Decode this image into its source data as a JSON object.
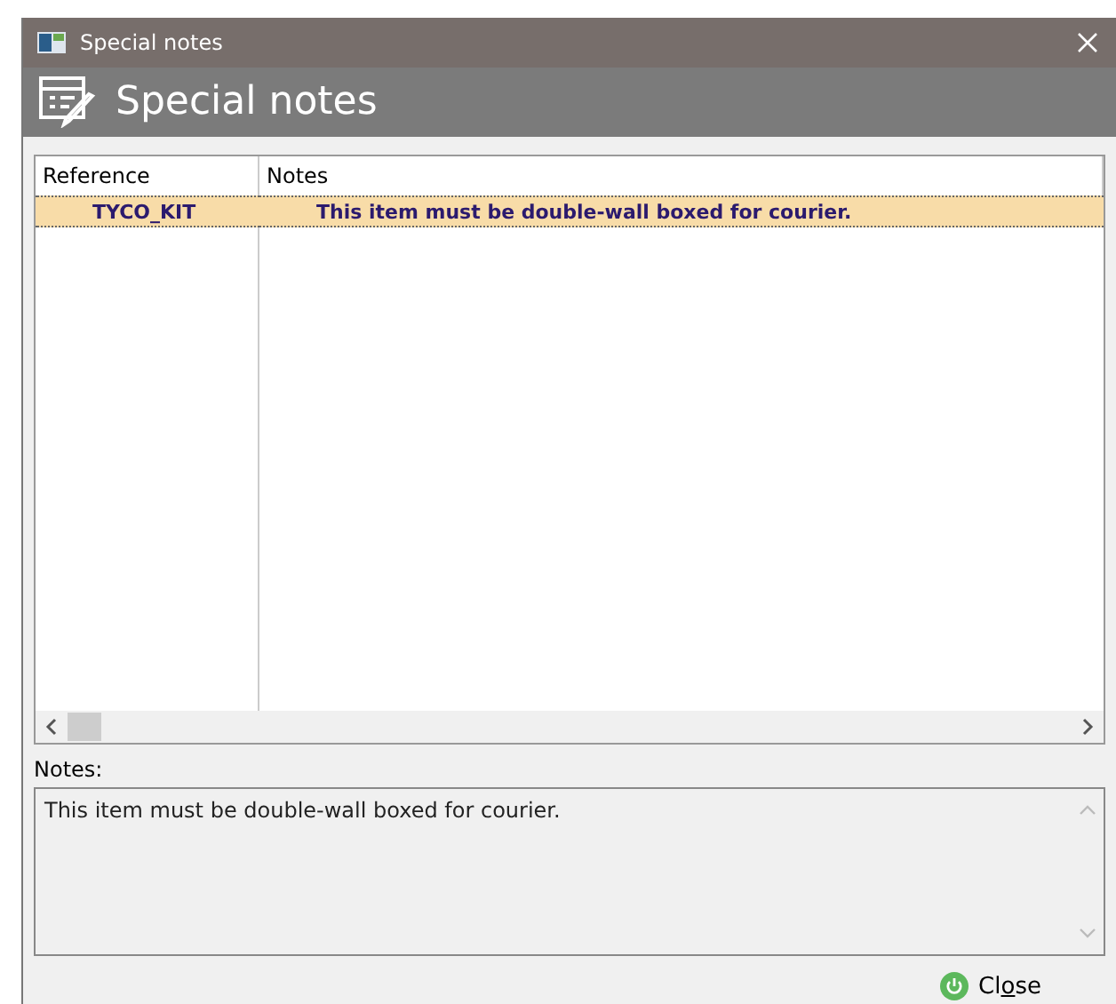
{
  "window": {
    "title": "Special notes"
  },
  "header": {
    "title": "Special notes"
  },
  "table": {
    "columns": [
      "Reference",
      "Notes"
    ],
    "rows": [
      {
        "reference": "TYCO_KIT",
        "notes": "This item must be double-wall boxed for courier.",
        "selected": true
      }
    ]
  },
  "notes": {
    "label": "Notes:",
    "value": "This item must be double-wall boxed for courier."
  },
  "close_button": {
    "label_before": "Cl",
    "access_key": "o",
    "label_after": "se"
  }
}
